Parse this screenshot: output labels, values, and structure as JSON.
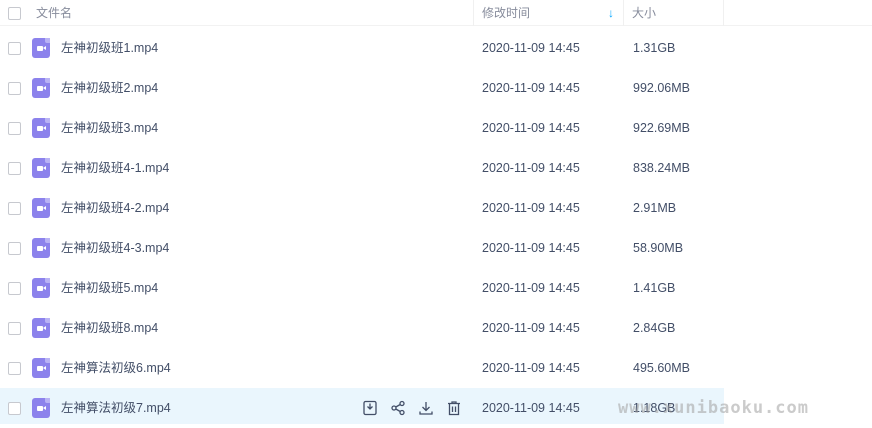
{
  "header": {
    "col_name": "文件名",
    "col_modified": "修改时间",
    "col_size": "大小",
    "sort_indicator": "↓"
  },
  "files": [
    {
      "name": "左神初级班1.mp4",
      "modified": "2020-11-09 14:45",
      "size": "1.31GB",
      "icon": "video-file-icon"
    },
    {
      "name": "左神初级班2.mp4",
      "modified": "2020-11-09 14:45",
      "size": "992.06MB",
      "icon": "video-file-icon"
    },
    {
      "name": "左神初级班3.mp4",
      "modified": "2020-11-09 14:45",
      "size": "922.69MB",
      "icon": "video-file-icon"
    },
    {
      "name": "左神初级班4-1.mp4",
      "modified": "2020-11-09 14:45",
      "size": "838.24MB",
      "icon": "video-file-icon"
    },
    {
      "name": "左神初级班4-2.mp4",
      "modified": "2020-11-09 14:45",
      "size": "2.91MB",
      "icon": "video-file-icon"
    },
    {
      "name": "左神初级班4-3.mp4",
      "modified": "2020-11-09 14:45",
      "size": "58.90MB",
      "icon": "video-file-icon"
    },
    {
      "name": "左神初级班5.mp4",
      "modified": "2020-11-09 14:45",
      "size": "1.41GB",
      "icon": "video-file-icon"
    },
    {
      "name": "左神初级班8.mp4",
      "modified": "2020-11-09 14:45",
      "size": "2.84GB",
      "icon": "video-file-icon"
    },
    {
      "name": "左神算法初级6.mp4",
      "modified": "2020-11-09 14:45",
      "size": "495.60MB",
      "icon": "video-file-icon"
    },
    {
      "name": "左神算法初级7.mp4",
      "modified": "2020-11-09 14:45",
      "size": "1.18GB",
      "icon": "video-file-icon"
    }
  ],
  "hover_actions": [
    "save-icon",
    "share-icon",
    "download-icon",
    "delete-icon"
  ],
  "watermark": "www.xunibaoku.com",
  "colors": {
    "accent": "#06a7ff",
    "hover_row": "#eaf6fd",
    "file_icon": "#8c82ec",
    "text": "#424e67",
    "header_text": "#878c9c"
  }
}
